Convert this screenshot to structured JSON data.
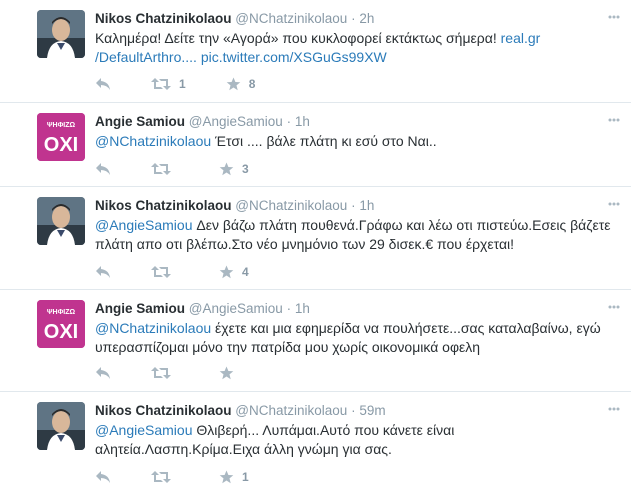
{
  "tweets": [
    {
      "avatar": "nikos",
      "fullname": "Nikos Chatzinikolaou",
      "screen_name": "@NChatzinikolaou",
      "time": "2h",
      "text_plain": "Καλημέρα! Δείτε την «Αγορά» που κυκλοφορεί εκτάκτως σήμερα! ",
      "text_link1": "real.gr",
      "text_link2": "/DefaultArthro....",
      "text_link3": "pic.twitter.com/XSGuGs99XW",
      "retweets": "1",
      "favorites": "8"
    },
    {
      "avatar": "angie",
      "fullname": "Angie Samiou",
      "screen_name": "@AngieSamiou",
      "time": "1h",
      "mention": "@NChatzinikolaou",
      "text_plain": " Έτσι .... βάλε πλάτη κι εσύ στο Ναι..",
      "retweets": "",
      "favorites": "3"
    },
    {
      "avatar": "nikos",
      "fullname": "Nikos Chatzinikolaou",
      "screen_name": "@NChatzinikolaou",
      "time": "1h",
      "mention": "@AngieSamiou",
      "text_plain": " Δεν βάζω πλάτη πουθενά.Γράφω και λέω οτι πιστεύω.Εσεις βάζετε πλάτη απο οτι βλέπω.Στο νέο μνημόνιο των 29 δισεκ.€ που έρχεται!",
      "retweets": "",
      "favorites": "4"
    },
    {
      "avatar": "angie",
      "fullname": "Angie Samiou",
      "screen_name": "@AngieSamiou",
      "time": "1h",
      "mention": "@NChatzinikolaou",
      "text_plain": " έχετε και μια εφημερίδα να πουλήσετε...σας καταλαβαίνω, εγώ υπερασπίζομαι μόνο την πατρίδα μου χωρίς οικονομικά οφελη",
      "retweets": "",
      "favorites": ""
    },
    {
      "avatar": "nikos",
      "fullname": "Nikos Chatzinikolaou",
      "screen_name": "@NChatzinikolaou",
      "time": "59m",
      "mention": "@AngieSamiou",
      "text_plain": " Θλιβερή... Λυπάμαι.Αυτό που κάνετε είναι αλητεία.Λασπη.Κρίμα.Ειχα άλλη γνώμη για σας.",
      "retweets": "",
      "favorites": "1"
    }
  ],
  "angie_avatar": {
    "top": "ΨΗΦΙΖΩ",
    "main": "ΟΧΙ"
  },
  "dot": "·",
  "colors": {
    "name": "#292f33",
    "meta": "#8899a6",
    "link": "#2b7bb9",
    "icon": "#aab8c2",
    "angie_avatar_bg": "#c0348f"
  },
  "icons": [
    "reply-icon",
    "retweet-icon",
    "favorite-star-icon",
    "more-options-icon"
  ]
}
